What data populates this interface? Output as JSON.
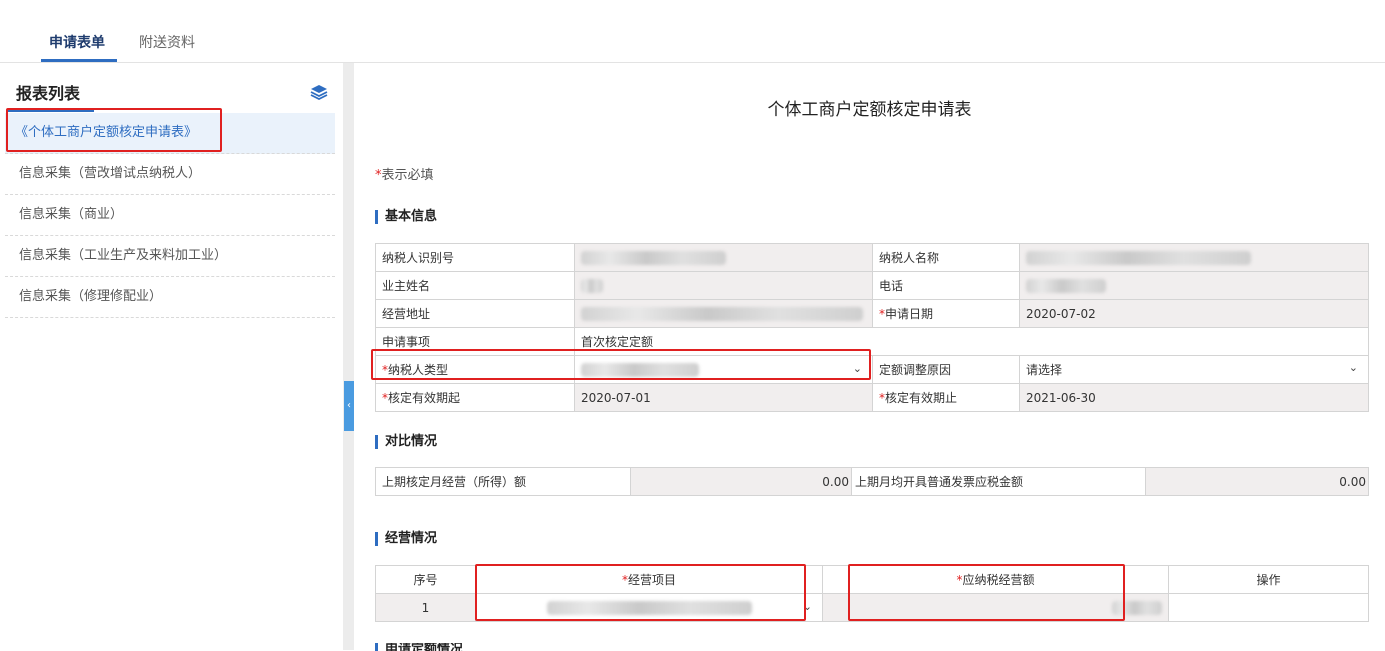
{
  "tabs": [
    {
      "label": "申请表单",
      "active": true
    },
    {
      "label": "附送资料",
      "active": false
    }
  ],
  "sidebar": {
    "title": "报表列表",
    "items": [
      {
        "label": "《个体工商户定额核定申请表》",
        "active": true
      },
      {
        "label": "信息采集（营改增试点纳税人）"
      },
      {
        "label": "信息采集（商业）"
      },
      {
        "label": "信息采集（工业生产及来料加工业）"
      },
      {
        "label": "信息采集（修理修配业）"
      }
    ]
  },
  "form": {
    "title": "个体工商户定额核定申请表",
    "required_note": "表示必填",
    "required_mark": "*"
  },
  "basic_info": {
    "section_title": "基本信息",
    "taxpayer_id_label": "纳税人识别号",
    "taxpayer_name_label": "纳税人名称",
    "owner_name_label": "业主姓名",
    "phone_label": "电话",
    "address_label": "经营地址",
    "apply_date_label": "申请日期",
    "apply_date_value": "2020-07-02",
    "apply_item_label": "申请事项",
    "apply_item_value": "首次核定定额",
    "taxpayer_type_label": "纳税人类型",
    "adjust_reason_label": "定额调整原因",
    "adjust_reason_value": "请选择",
    "valid_from_label": "核定有效期起",
    "valid_from_value": "2020-07-01",
    "valid_to_label": "核定有效期止",
    "valid_to_value": "2021-06-30"
  },
  "comparison": {
    "section_title": "对比情况",
    "prev_amount_label": "上期核定月经营（所得）额",
    "prev_amount_value": "0.00",
    "prev_invoice_label": "上期月均开具普通发票应税金额",
    "prev_invoice_value": "0.00"
  },
  "business": {
    "section_title": "经营情况",
    "columns": [
      "序号",
      "经营项目",
      "应纳税经营额",
      "操作"
    ],
    "rows": [
      {
        "index": "1"
      }
    ]
  },
  "next_section_title": "申请定额情况",
  "colors": {
    "accent": "#2e6dc1",
    "highlight": "#e02020"
  }
}
